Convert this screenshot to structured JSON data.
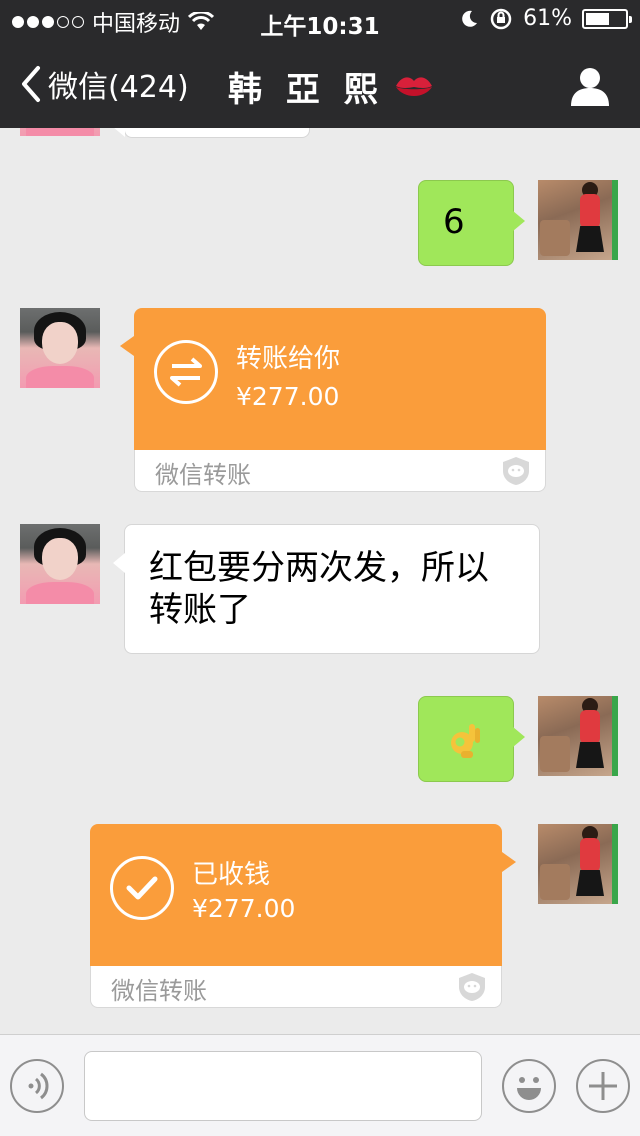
{
  "status_bar": {
    "carrier": "中国移动",
    "time": "上午10:31",
    "battery": "61%",
    "battery_level": 0.61
  },
  "nav": {
    "back_label": "微信(424)",
    "title": "韩 亞 熙"
  },
  "messages": [
    {
      "side": "right",
      "type": "text",
      "text": "6"
    },
    {
      "side": "left",
      "type": "transfer",
      "title": "转账给你",
      "amount": "¥277.00",
      "footer": "微信转账"
    },
    {
      "side": "left",
      "type": "text",
      "line1": "红包要分两次发，所以",
      "line2": "转账了"
    },
    {
      "side": "right",
      "type": "emoji",
      "emoji": "ok-hand-emoji"
    },
    {
      "side": "right",
      "type": "transfer",
      "title": "已收钱",
      "amount": "¥277.00",
      "footer": "微信转账"
    }
  ],
  "input_bar": {
    "text_value": "",
    "icons": [
      "voice-icon",
      "emoji-icon",
      "plus-icon"
    ]
  },
  "colors": {
    "nav_bg": "#2a2a2c",
    "chat_bg": "#ebebeb",
    "my_bubble": "#a0e75a",
    "transfer_orange": "#fa9d3b"
  }
}
